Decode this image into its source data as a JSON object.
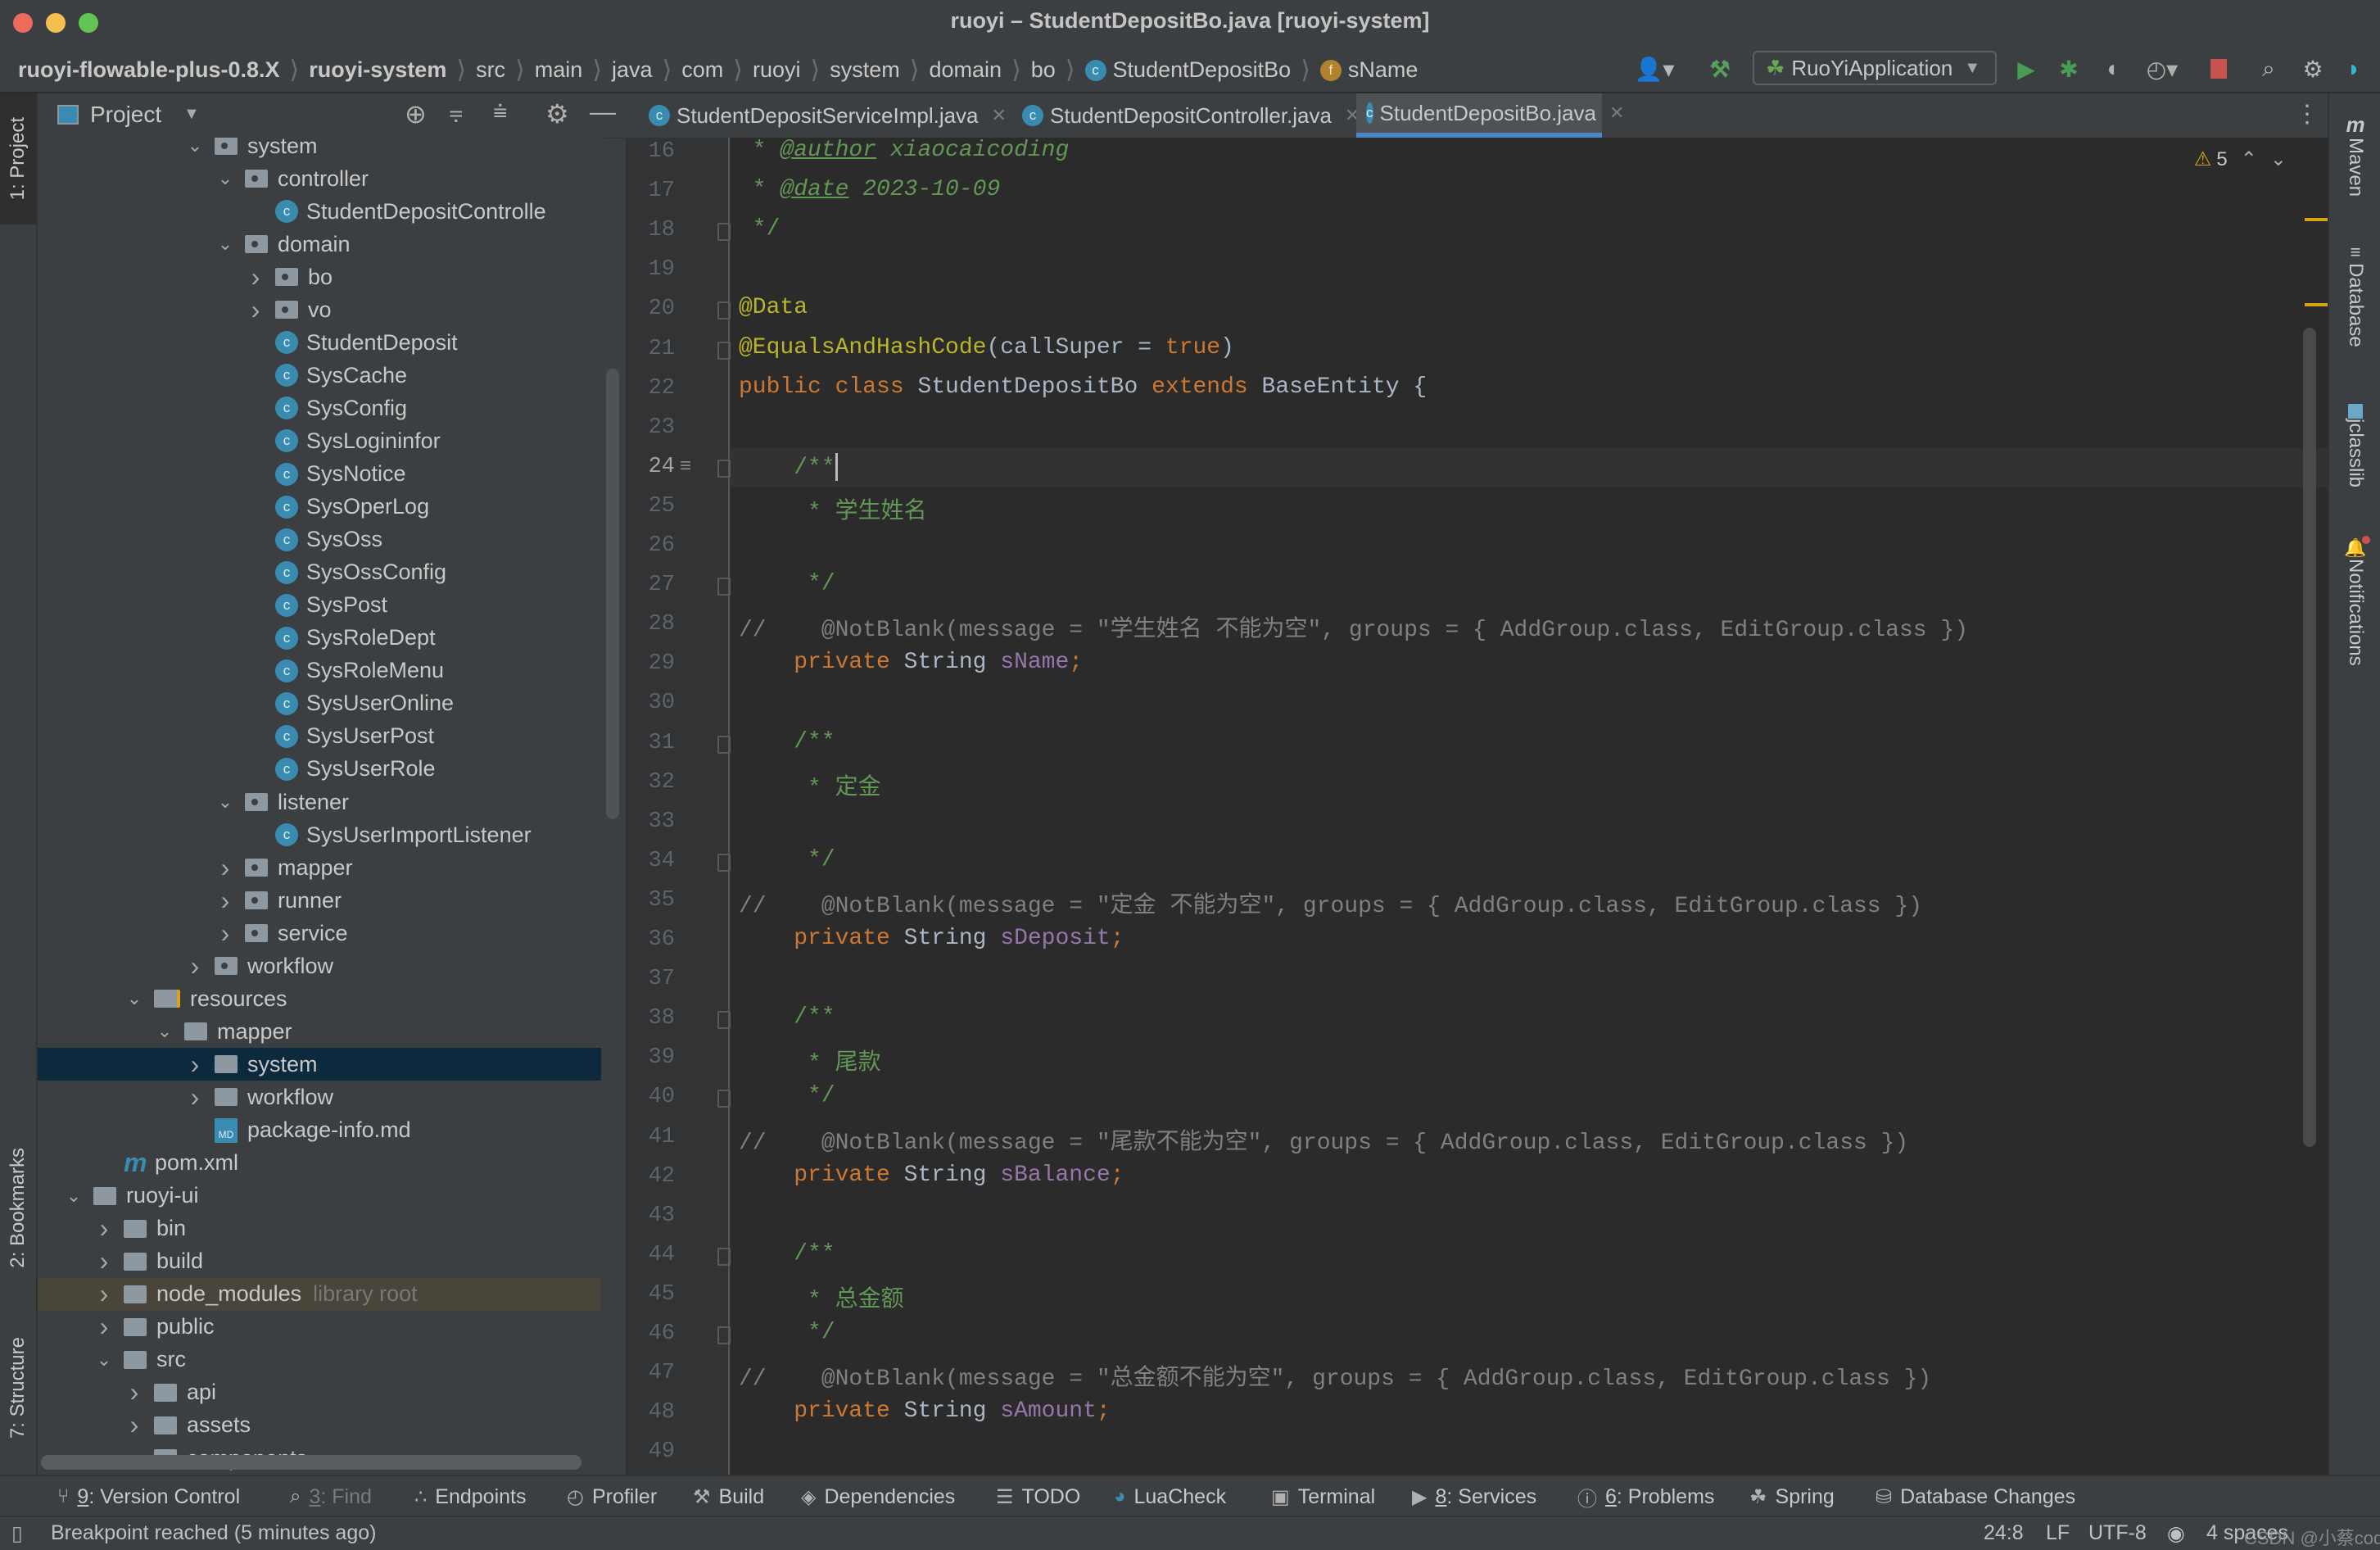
{
  "window": {
    "title": "ruoyi – StudentDepositBo.java [ruoyi-system]",
    "traffic_lights": {
      "close": "#ed6a5e",
      "minimize": "#f5bf4f",
      "zoom": "#61c554"
    }
  },
  "breadcrumb": [
    {
      "label": "ruoyi-flowable-plus-0.8.X",
      "bold": true
    },
    {
      "label": "ruoyi-system",
      "bold": true
    },
    {
      "label": "src"
    },
    {
      "label": "main"
    },
    {
      "label": "java"
    },
    {
      "label": "com"
    },
    {
      "label": "ruoyi"
    },
    {
      "label": "system"
    },
    {
      "label": "domain"
    },
    {
      "label": "bo"
    },
    {
      "label": "StudentDepositBo",
      "icon": "class-icon"
    },
    {
      "label": "sName",
      "icon": "field-icon"
    }
  ],
  "toolbar": {
    "run_config": "RuoYiApplication",
    "icons": [
      "user-icon",
      "build-hammer-icon",
      "run-icon",
      "debug-icon",
      "coverage-icon",
      "profile-icon",
      "stop-icon",
      "search-icon",
      "settings-icon",
      "toolbox-icon"
    ]
  },
  "left_strip": {
    "project": "1: Project",
    "bookmarks": "2: Bookmarks",
    "structure": "7: Structure"
  },
  "project_panel": {
    "title": "Project",
    "tree": [
      {
        "label": "system",
        "depth": 6,
        "type": "pkg",
        "expanded": true,
        "partial": true
      },
      {
        "label": "controller",
        "depth": 7,
        "type": "pkg",
        "expanded": true
      },
      {
        "label": "StudentDepositControlle",
        "depth": 8,
        "type": "class"
      },
      {
        "label": "domain",
        "depth": 7,
        "type": "pkg",
        "expanded": true
      },
      {
        "label": "bo",
        "depth": 8,
        "type": "pkg",
        "expanded": false
      },
      {
        "label": "vo",
        "depth": 8,
        "type": "pkg",
        "expanded": false
      },
      {
        "label": "StudentDeposit",
        "depth": 8,
        "type": "class"
      },
      {
        "label": "SysCache",
        "depth": 8,
        "type": "class"
      },
      {
        "label": "SysConfig",
        "depth": 8,
        "type": "class"
      },
      {
        "label": "SysLogininfor",
        "depth": 8,
        "type": "class"
      },
      {
        "label": "SysNotice",
        "depth": 8,
        "type": "class"
      },
      {
        "label": "SysOperLog",
        "depth": 8,
        "type": "class"
      },
      {
        "label": "SysOss",
        "depth": 8,
        "type": "class"
      },
      {
        "label": "SysOssConfig",
        "depth": 8,
        "type": "class"
      },
      {
        "label": "SysPost",
        "depth": 8,
        "type": "class"
      },
      {
        "label": "SysRoleDept",
        "depth": 8,
        "type": "class"
      },
      {
        "label": "SysRoleMenu",
        "depth": 8,
        "type": "class"
      },
      {
        "label": "SysUserOnline",
        "depth": 8,
        "type": "class"
      },
      {
        "label": "SysUserPost",
        "depth": 8,
        "type": "class"
      },
      {
        "label": "SysUserRole",
        "depth": 8,
        "type": "class"
      },
      {
        "label": "listener",
        "depth": 7,
        "type": "pkg",
        "expanded": true
      },
      {
        "label": "SysUserImportListener",
        "depth": 8,
        "type": "class"
      },
      {
        "label": "mapper",
        "depth": 7,
        "type": "pkg",
        "expanded": false
      },
      {
        "label": "runner",
        "depth": 7,
        "type": "pkg",
        "expanded": false
      },
      {
        "label": "service",
        "depth": 7,
        "type": "pkg",
        "expanded": false
      },
      {
        "label": "workflow",
        "depth": 6,
        "type": "pkg",
        "expanded": false
      },
      {
        "label": "resources",
        "depth": 4,
        "type": "res",
        "expanded": true
      },
      {
        "label": "mapper",
        "depth": 5,
        "type": "dir",
        "expanded": true
      },
      {
        "label": "system",
        "depth": 6,
        "type": "dir",
        "expanded": false,
        "selected": true
      },
      {
        "label": "workflow",
        "depth": 6,
        "type": "dir",
        "expanded": false
      },
      {
        "label": "package-info.md",
        "depth": 6,
        "type": "md"
      },
      {
        "label": "pom.xml",
        "depth": 3,
        "type": "maven"
      },
      {
        "label": "ruoyi-ui",
        "depth": 2,
        "type": "dir",
        "expanded": true
      },
      {
        "label": "bin",
        "depth": 3,
        "type": "dir",
        "expanded": false
      },
      {
        "label": "build",
        "depth": 3,
        "type": "dir",
        "expanded": false
      },
      {
        "label": "node_modules",
        "depth": 3,
        "type": "dir",
        "expanded": false,
        "hint": "library root",
        "library": true
      },
      {
        "label": "public",
        "depth": 3,
        "type": "dir",
        "expanded": false
      },
      {
        "label": "src",
        "depth": 3,
        "type": "dir",
        "expanded": true
      },
      {
        "label": "api",
        "depth": 4,
        "type": "dir",
        "expanded": false
      },
      {
        "label": "assets",
        "depth": 4,
        "type": "dir",
        "expanded": false
      },
      {
        "label": "components",
        "depth": 4,
        "type": "dir",
        "expanded": false,
        "partial": true
      }
    ]
  },
  "editor": {
    "tabs": [
      {
        "label": "StudentDepositServiceImpl.java",
        "active": false
      },
      {
        "label": "StudentDepositController.java",
        "active": false
      },
      {
        "label": "StudentDepositBo.java",
        "active": true
      }
    ],
    "warnings_count": "5",
    "current_line": 24,
    "lines": [
      {
        "n": "16",
        "segs": [
          [
            " * ",
            "doc"
          ],
          [
            "@author",
            "tag"
          ],
          [
            " xiaocaicoding",
            "cm"
          ]
        ]
      },
      {
        "n": "17",
        "segs": [
          [
            " * ",
            "doc"
          ],
          [
            "@date",
            "tag"
          ],
          [
            " 2023-10-09",
            "cm"
          ]
        ]
      },
      {
        "n": "18",
        "segs": [
          [
            " */",
            "doc"
          ]
        ],
        "fold": true
      },
      {
        "n": "19",
        "segs": []
      },
      {
        "n": "20",
        "segs": [
          [
            "@Data",
            "ann"
          ]
        ],
        "fold": true
      },
      {
        "n": "21",
        "segs": [
          [
            "@EqualsAndHashCode",
            "ann"
          ],
          [
            "(callSuper = ",
            ""
          ],
          [
            "true",
            "kw"
          ],
          [
            ")",
            ""
          ]
        ],
        "fold": true
      },
      {
        "n": "22",
        "segs": [
          [
            "public class ",
            "kw"
          ],
          [
            "StudentDepositBo ",
            ""
          ],
          [
            "extends ",
            "kw"
          ],
          [
            "BaseEntity {",
            ""
          ]
        ]
      },
      {
        "n": "23",
        "segs": []
      },
      {
        "n": "24",
        "segs": [
          [
            "    /**",
            "doc"
          ]
        ],
        "fold": true,
        "caret": true
      },
      {
        "n": "25",
        "segs": [
          [
            "     * 学生姓名",
            "doc"
          ]
        ]
      },
      {
        "n": "26",
        "segs": []
      },
      {
        "n": "27",
        "segs": [
          [
            "     */",
            "doc"
          ]
        ],
        "fold": true
      },
      {
        "n": "28",
        "segs": [
          [
            "//    @NotBlank(message = \"学生姓名 不能为空\", groups = { AddGroup.class, EditGroup.class })",
            "lc"
          ]
        ]
      },
      {
        "n": "29",
        "segs": [
          [
            "    private ",
            "kw"
          ],
          [
            "String ",
            ""
          ],
          [
            "sName",
            "fld"
          ],
          [
            ";",
            "kw"
          ]
        ]
      },
      {
        "n": "30",
        "segs": []
      },
      {
        "n": "31",
        "segs": [
          [
            "    /**",
            "doc"
          ]
        ],
        "fold": true
      },
      {
        "n": "32",
        "segs": [
          [
            "     * 定金",
            "doc"
          ]
        ]
      },
      {
        "n": "33",
        "segs": []
      },
      {
        "n": "34",
        "segs": [
          [
            "     */",
            "doc"
          ]
        ],
        "fold": true
      },
      {
        "n": "35",
        "segs": [
          [
            "//    @NotBlank(message = \"定金 不能为空\", groups = { AddGroup.class, EditGroup.class })",
            "lc"
          ]
        ]
      },
      {
        "n": "36",
        "segs": [
          [
            "    private ",
            "kw"
          ],
          [
            "String ",
            ""
          ],
          [
            "sDeposit",
            "fld"
          ],
          [
            ";",
            "kw"
          ]
        ]
      },
      {
        "n": "37",
        "segs": []
      },
      {
        "n": "38",
        "segs": [
          [
            "    /**",
            "doc"
          ]
        ],
        "fold": true
      },
      {
        "n": "39",
        "segs": [
          [
            "     * 尾款",
            "doc"
          ]
        ]
      },
      {
        "n": "40",
        "segs": [
          [
            "     */",
            "doc"
          ]
        ],
        "fold": true
      },
      {
        "n": "41",
        "segs": [
          [
            "//    @NotBlank(message = \"尾款不能为空\", groups = { AddGroup.class, EditGroup.class })",
            "lc"
          ]
        ]
      },
      {
        "n": "42",
        "segs": [
          [
            "    private ",
            "kw"
          ],
          [
            "String ",
            ""
          ],
          [
            "sBalance",
            "fld"
          ],
          [
            ";",
            "kw"
          ]
        ]
      },
      {
        "n": "43",
        "segs": []
      },
      {
        "n": "44",
        "segs": [
          [
            "    /**",
            "doc"
          ]
        ],
        "fold": true
      },
      {
        "n": "45",
        "segs": [
          [
            "     * 总金额",
            "doc"
          ]
        ]
      },
      {
        "n": "46",
        "segs": [
          [
            "     */",
            "doc"
          ]
        ],
        "fold": true
      },
      {
        "n": "47",
        "segs": [
          [
            "//    @NotBlank(message = \"总金额不能为空\", groups = { AddGroup.class, EditGroup.class })",
            "lc"
          ]
        ]
      },
      {
        "n": "48",
        "segs": [
          [
            "    private ",
            "kw"
          ],
          [
            "String ",
            ""
          ],
          [
            "sAmount",
            "fld"
          ],
          [
            ";",
            "kw"
          ]
        ]
      },
      {
        "n": "49",
        "segs": []
      }
    ]
  },
  "right_strip": [
    "Maven",
    "Database",
    "jclasslib",
    "Notifications"
  ],
  "tool_windows": [
    {
      "key": "9",
      "label": ": Version Control",
      "icon": "branch-icon"
    },
    {
      "key": "3",
      "label": ": Find",
      "icon": "search-icon",
      "disabled": true
    },
    {
      "key": "",
      "label": "Endpoints",
      "icon": "endpoints-icon"
    },
    {
      "key": "",
      "label": "Profiler",
      "icon": "profiler-icon"
    },
    {
      "key": "",
      "label": "Build",
      "icon": "hammer-icon"
    },
    {
      "key": "",
      "label": "Dependencies",
      "icon": "dependencies-icon"
    },
    {
      "key": "",
      "label": "TODO",
      "icon": "list-icon"
    },
    {
      "key": "",
      "label": "LuaCheck",
      "icon": "luacheck-icon"
    },
    {
      "key": "",
      "label": "Terminal",
      "icon": "terminal-icon"
    },
    {
      "key": "8",
      "label": ": Services",
      "icon": "services-icon"
    },
    {
      "key": "6",
      "label": ": Problems",
      "icon": "problems-icon"
    },
    {
      "key": "",
      "label": "Spring",
      "icon": "spring-icon"
    },
    {
      "key": "",
      "label": "Database Changes",
      "icon": "db-changes-icon"
    }
  ],
  "status_bar": {
    "message": "Breakpoint reached (5 minutes ago)",
    "position": "24:8",
    "line_sep": "LF",
    "encoding": "UTF-8",
    "indent": "4 spaces",
    "watermark": "CSDN @小蔡coding"
  }
}
